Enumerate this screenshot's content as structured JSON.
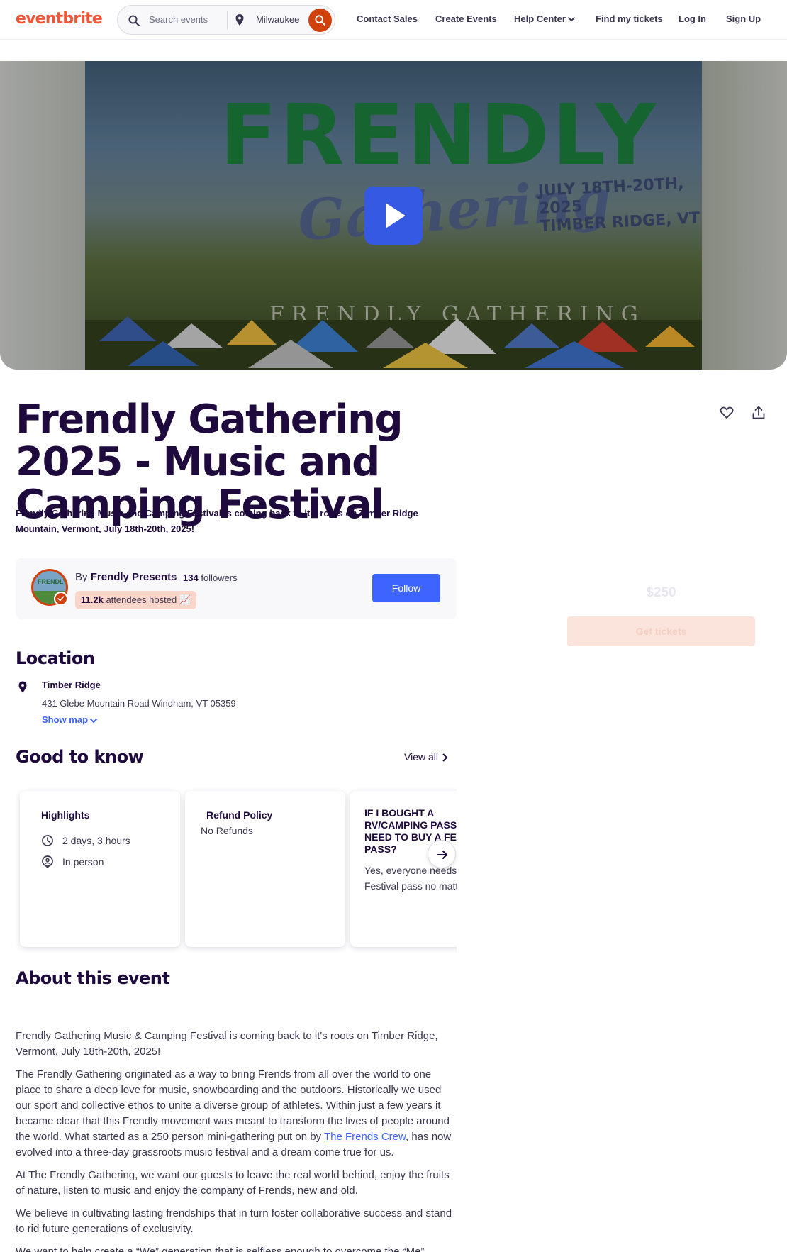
{
  "header": {
    "logo": "eventbrite",
    "search_placeholder": "Search events",
    "location": "Milwaukee",
    "nav": {
      "contact_sales": "Contact Sales",
      "create_events": "Create Events",
      "help_center": "Help Center",
      "find_tickets": "Find my tickets",
      "log_in": "Log In",
      "sign_up": "Sign Up"
    }
  },
  "hero": {
    "artwork_title": "FRENDLY",
    "artwork_script": "Gathering",
    "artwork_dates": "JULY 18TH-20TH, 2025",
    "artwork_place": "TIMBER RIDGE, VT",
    "artwork_footer": "FRENDLY GATHERING"
  },
  "event": {
    "title": "Frendly Gathering 2025 - Music and Camping Festival",
    "summary": "Frendly Gathering Music and Camping Festival is coming back to it's roots on Timber Ridge Mountain, Vermont, July 18th-20th, 2025!"
  },
  "organizer": {
    "by_prefix": "By",
    "name": "Frendly Presents",
    "avatar_text": "FRENDLY",
    "followers_count": "134",
    "followers_label": "followers",
    "attendees_count": "11.2k",
    "attendees_label": "attendees hosted",
    "attendees_emoji": "📈",
    "follow_label": "Follow"
  },
  "tickets": {
    "price": "$250",
    "button": "Get tickets"
  },
  "location": {
    "heading": "Location",
    "venue": "Timber Ridge",
    "address": "431 Glebe Mountain Road Windham, VT 05359",
    "show_map": "Show map"
  },
  "good_to_know": {
    "heading": "Good to know",
    "view_all": "View all",
    "highlights": {
      "title": "Highlights",
      "duration": "2 days, 3 hours",
      "format": "In person"
    },
    "refund": {
      "title": "Refund Policy",
      "text": "No Refunds"
    },
    "faq": {
      "question": "IF I BOUGHT A RV/CAMPING PASS, DO I NEED TO BUY A FESTIVAL PASS?",
      "answer": "Yes, everyone needs a Festival pass no matter"
    }
  },
  "about": {
    "heading": "About this event",
    "p1": "Frendly Gathering Music & Camping Festival is coming back to it's roots on Timber Ridge, Vermont, July 18th-20th, 2025!",
    "p2_before": "The Frendly Gathering originated as a way to bring Frends from all over the world to one place to share a deep love for music, snowboarding and the outdoors. Historically we used our sport and collective ethos to unite a diverse group of athletes. Within just a few years it became clear that this Frendly movement was meant to transform the lives of people around the world. What started as a 250 person mini-gathering put on by ",
    "p2_link": "The Frends Crew",
    "p2_after": ", has now evolved into a three-day grassroots music festival and a dream come true for us.",
    "p3": "At The Frendly Gathering, we want our guests to leave the real world behind, enjoy the fruits of nature, listen to music and enjoy the company of Frends, new and old.",
    "p4": "We believe in cultivating lasting  frendships that in turn foster collaborative success and stand to rid future generations of exclusivity.",
    "p5": "We want to help create a “We” generation that is selfless enough to overcome the “Me”"
  },
  "colors": {
    "brand": "#f05537",
    "accent": "#3d64ff",
    "play": "#3659e3",
    "search_go": "#d1410c",
    "heading": "#1e0a3c"
  },
  "icons": [
    "search-icon",
    "location-pin-icon",
    "chevron-down-icon",
    "play-icon",
    "heart-icon",
    "share-icon",
    "verified-badge-icon",
    "clock-icon",
    "person-pin-icon",
    "chevron-right-icon",
    "arrow-right-icon"
  ]
}
